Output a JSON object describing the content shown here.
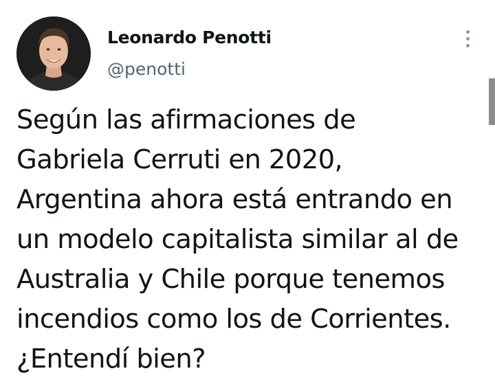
{
  "author": {
    "display_name": "Leonardo Penotti",
    "handle": "@penotti",
    "avatar_icon": "profile-photo"
  },
  "more_icon": "vertical-ellipsis-icon",
  "tweet": {
    "lines": [
      "Según las afirmaciones de",
      "Gabriela Cerruti en 2020,",
      "Argentina ahora está entrando en",
      "un modelo capitalista similar al de",
      "Australia y Chile porque tenemos",
      "incendios como los de Corrientes.",
      "¿Entendí bien?"
    ]
  },
  "colors": {
    "name": "#0f1419",
    "handle": "#536471",
    "icon": "#8b98a5",
    "scrollbar": "#8c8c8c"
  }
}
